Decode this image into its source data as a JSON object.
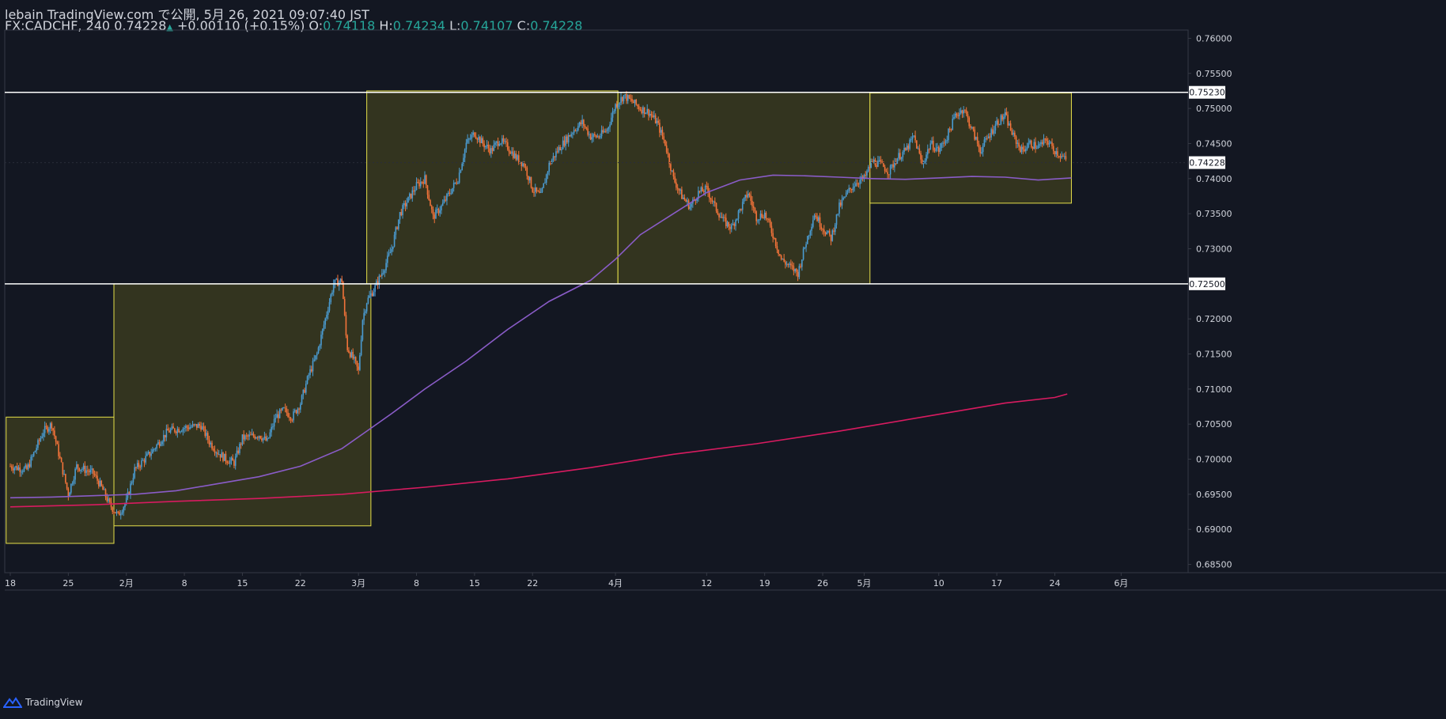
{
  "header": {
    "publish_line": "lebain TradingView.com で公開, 5月 26, 2021 09:07:40 JST",
    "symbol_interval": "FX:CADCHF, 240",
    "last_price": "0.74228",
    "change_arrow": "▲",
    "change": "+0.00110 (+0.15%)",
    "open_label": "O:",
    "open": "0.74118",
    "high_label": "H:",
    "high": "0.74234",
    "low_label": "L:",
    "low": "0.74107",
    "close_label": "C:",
    "close": "0.74228"
  },
  "footer": {
    "brand": "TradingView",
    "logo_icon": "tradingview-logo-icon"
  },
  "colors": {
    "background": "#131722",
    "up_candle": "#4a9bd1",
    "down_candle": "#f2733a",
    "box_fill": "#3a3a1e",
    "box_stroke": "#e6e04a",
    "ma_fast": "#8a5cc8",
    "ma_slow": "#d81b60",
    "level_line": "#ffffff",
    "axis_text": "#d1d4dc",
    "current_price_label": "#ffffff"
  },
  "chart_data": {
    "type": "candlestick",
    "symbol": "FX:CADCHF",
    "interval": "240",
    "y_range": [
      0.6845,
      0.7605
    ],
    "y_ticks": [
      "0.76000",
      "0.75500",
      "0.75000",
      "0.74500",
      "0.74000",
      "0.73500",
      "0.73000",
      "0.72500",
      "0.72000",
      "0.71500",
      "0.71000",
      "0.70500",
      "0.70000",
      "0.69500",
      "0.69000",
      "0.68500"
    ],
    "x_range_days": [
      0,
      146
    ],
    "x_ticks": [
      {
        "label": "18",
        "day": 0
      },
      {
        "label": "25",
        "day": 7
      },
      {
        "label": "2月",
        "day": 14
      },
      {
        "label": "8",
        "day": 21
      },
      {
        "label": "15",
        "day": 28
      },
      {
        "label": "22",
        "day": 35
      },
      {
        "label": "3月",
        "day": 42
      },
      {
        "label": "8",
        "day": 49
      },
      {
        "label": "15",
        "day": 56
      },
      {
        "label": "22",
        "day": 63
      },
      {
        "label": "4月",
        "day": 73
      },
      {
        "label": "12",
        "day": 84
      },
      {
        "label": "19",
        "day": 91
      },
      {
        "label": "26",
        "day": 98
      },
      {
        "label": "5月",
        "day": 103
      },
      {
        "label": "10",
        "day": 112
      },
      {
        "label": "17",
        "day": 119
      },
      {
        "label": "24",
        "day": 126
      },
      {
        "label": "6月",
        "day": 134
      }
    ],
    "horizontal_levels": [
      {
        "price": 0.7523,
        "label": "0.75230"
      },
      {
        "price": 0.725,
        "label": "0.72500"
      }
    ],
    "current_price": {
      "price": 0.74228,
      "label": "0.74228"
    },
    "boxes": [
      {
        "day_start": -0.5,
        "day_end": 12.5,
        "price_top": 0.706,
        "price_bottom": 0.688
      },
      {
        "day_start": 12.5,
        "day_end": 43.5,
        "price_top": 0.725,
        "price_bottom": 0.6905
      },
      {
        "day_start": 43.0,
        "day_end": 73.3,
        "price_top": 0.7525,
        "price_bottom": 0.725
      },
      {
        "day_start": 73.3,
        "day_end": 103.7,
        "price_top": 0.7523,
        "price_bottom": 0.725
      },
      {
        "day_start": 103.7,
        "day_end": 128.0,
        "price_top": 0.7522,
        "price_bottom": 0.7365
      }
    ],
    "close_anchors": [
      [
        0,
        0.699
      ],
      [
        2,
        0.6985
      ],
      [
        4,
        0.704
      ],
      [
        5,
        0.705
      ],
      [
        7,
        0.695
      ],
      [
        8,
        0.699
      ],
      [
        10,
        0.698
      ],
      [
        11,
        0.696
      ],
      [
        12,
        0.6935
      ],
      [
        13,
        0.692
      ],
      [
        14,
        0.694
      ],
      [
        15,
        0.6985
      ],
      [
        17,
        0.701
      ],
      [
        19,
        0.704
      ],
      [
        21,
        0.7045
      ],
      [
        23,
        0.7048
      ],
      [
        24,
        0.7025
      ],
      [
        25,
        0.701
      ],
      [
        26,
        0.7
      ],
      [
        27,
        0.6995
      ],
      [
        28,
        0.703
      ],
      [
        30,
        0.7035
      ],
      [
        31,
        0.7025
      ],
      [
        32,
        0.706
      ],
      [
        33,
        0.707
      ],
      [
        34,
        0.706
      ],
      [
        35,
        0.708
      ],
      [
        36,
        0.712
      ],
      [
        37,
        0.715
      ],
      [
        38,
        0.72
      ],
      [
        39,
        0.725
      ],
      [
        40,
        0.7255
      ],
      [
        40.6,
        0.716
      ],
      [
        41.5,
        0.714
      ],
      [
        42,
        0.7125
      ],
      [
        42.5,
        0.72
      ],
      [
        43,
        0.7225
      ],
      [
        44,
        0.7245
      ],
      [
        45,
        0.727
      ],
      [
        46,
        0.73
      ],
      [
        47,
        0.735
      ],
      [
        48,
        0.737
      ],
      [
        49,
        0.739
      ],
      [
        50,
        0.74
      ],
      [
        51,
        0.7345
      ],
      [
        52,
        0.736
      ],
      [
        53,
        0.738
      ],
      [
        54,
        0.74
      ],
      [
        55,
        0.745
      ],
      [
        56,
        0.7465
      ],
      [
        57,
        0.745
      ],
      [
        58,
        0.744
      ],
      [
        59,
        0.7455
      ],
      [
        60,
        0.7445
      ],
      [
        61,
        0.743
      ],
      [
        62,
        0.742
      ],
      [
        63,
        0.7385
      ],
      [
        64,
        0.7375
      ],
      [
        65,
        0.742
      ],
      [
        66,
        0.744
      ],
      [
        67,
        0.7455
      ],
      [
        68,
        0.747
      ],
      [
        69,
        0.748
      ],
      [
        70,
        0.746
      ],
      [
        71,
        0.746
      ],
      [
        72,
        0.747
      ],
      [
        73,
        0.7505
      ],
      [
        74,
        0.7518
      ],
      [
        75,
        0.751
      ],
      [
        76,
        0.75
      ],
      [
        77,
        0.7495
      ],
      [
        78,
        0.748
      ],
      [
        79,
        0.745
      ],
      [
        80,
        0.74
      ],
      [
        81,
        0.7375
      ],
      [
        82,
        0.736
      ],
      [
        83,
        0.738
      ],
      [
        84,
        0.7385
      ],
      [
        85,
        0.736
      ],
      [
        86,
        0.734
      ],
      [
        87,
        0.733
      ],
      [
        88,
        0.7355
      ],
      [
        89,
        0.738
      ],
      [
        90,
        0.7345
      ],
      [
        91,
        0.735
      ],
      [
        92,
        0.732
      ],
      [
        93,
        0.7285
      ],
      [
        94,
        0.7275
      ],
      [
        95,
        0.7265
      ],
      [
        96,
        0.731
      ],
      [
        97,
        0.735
      ],
      [
        98,
        0.733
      ],
      [
        99,
        0.7315
      ],
      [
        100,
        0.736
      ],
      [
        101,
        0.738
      ],
      [
        102,
        0.7395
      ],
      [
        103,
        0.74
      ],
      [
        104,
        0.7425
      ],
      [
        105,
        0.742
      ],
      [
        106,
        0.741
      ],
      [
        107,
        0.743
      ],
      [
        108,
        0.744
      ],
      [
        109,
        0.746
      ],
      [
        110,
        0.742
      ],
      [
        111,
        0.745
      ],
      [
        112,
        0.744
      ],
      [
        113,
        0.746
      ],
      [
        114,
        0.749
      ],
      [
        115,
        0.75
      ],
      [
        116,
        0.747
      ],
      [
        117,
        0.744
      ],
      [
        118,
        0.746
      ],
      [
        119,
        0.748
      ],
      [
        120,
        0.749
      ],
      [
        121,
        0.746
      ],
      [
        122,
        0.744
      ],
      [
        123,
        0.745
      ],
      [
        124,
        0.7445
      ],
      [
        125,
        0.7455
      ],
      [
        126,
        0.744
      ],
      [
        127,
        0.743
      ],
      [
        127.5,
        0.74228
      ]
    ],
    "ma_fast_points": [
      [
        0,
        0.6945
      ],
      [
        5,
        0.6946
      ],
      [
        10,
        0.6948
      ],
      [
        15,
        0.695
      ],
      [
        20,
        0.6955
      ],
      [
        25,
        0.6965
      ],
      [
        30,
        0.6975
      ],
      [
        35,
        0.699
      ],
      [
        40,
        0.7015
      ],
      [
        43,
        0.704
      ],
      [
        46,
        0.7065
      ],
      [
        50,
        0.71
      ],
      [
        55,
        0.714
      ],
      [
        60,
        0.7185
      ],
      [
        65,
        0.7225
      ],
      [
        70,
        0.7255
      ],
      [
        73,
        0.7285
      ],
      [
        76,
        0.732
      ],
      [
        80,
        0.735
      ],
      [
        84,
        0.738
      ],
      [
        88,
        0.7398
      ],
      [
        92,
        0.7405
      ],
      [
        96,
        0.7404
      ],
      [
        100,
        0.7402
      ],
      [
        104,
        0.74
      ],
      [
        108,
        0.7399
      ],
      [
        112,
        0.7401
      ],
      [
        116,
        0.7403
      ],
      [
        120,
        0.7402
      ],
      [
        124,
        0.7398
      ],
      [
        128,
        0.7401
      ]
    ],
    "ma_slow_points": [
      [
        0,
        0.6932
      ],
      [
        10,
        0.6935
      ],
      [
        20,
        0.694
      ],
      [
        30,
        0.6944
      ],
      [
        40,
        0.695
      ],
      [
        50,
        0.696
      ],
      [
        60,
        0.6972
      ],
      [
        70,
        0.6988
      ],
      [
        80,
        0.7007
      ],
      [
        90,
        0.7022
      ],
      [
        100,
        0.704
      ],
      [
        110,
        0.706
      ],
      [
        120,
        0.708
      ],
      [
        126,
        0.7088
      ],
      [
        127.5,
        0.7093
      ]
    ]
  }
}
